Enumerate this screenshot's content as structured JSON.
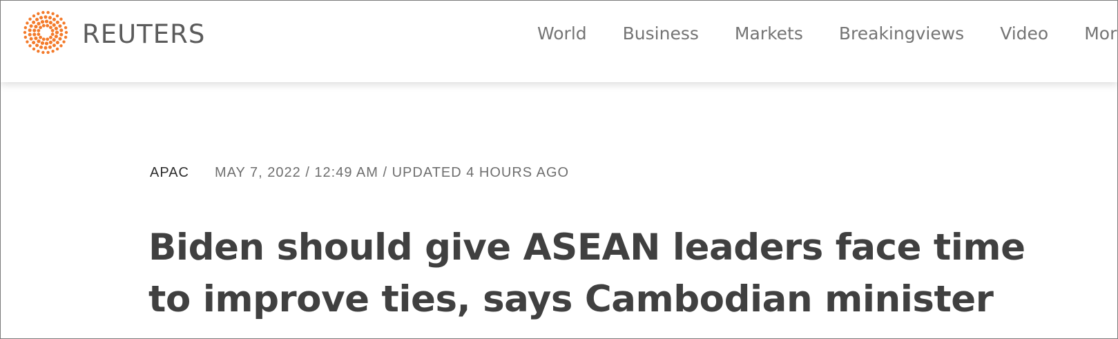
{
  "brand": {
    "name": "REUTERS",
    "logo_color": "#f37a2a"
  },
  "nav": {
    "items": [
      {
        "label": "World"
      },
      {
        "label": "Business"
      },
      {
        "label": "Markets"
      },
      {
        "label": "Breakingviews"
      },
      {
        "label": "Video"
      },
      {
        "label": "More"
      }
    ]
  },
  "article": {
    "section": "APAC",
    "dateline": "MAY 7, 2022 / 12:49 AM / UPDATED 4 HOURS AGO",
    "headline": "Biden should give ASEAN leaders face time to improve ties, says Cambodian minister"
  }
}
